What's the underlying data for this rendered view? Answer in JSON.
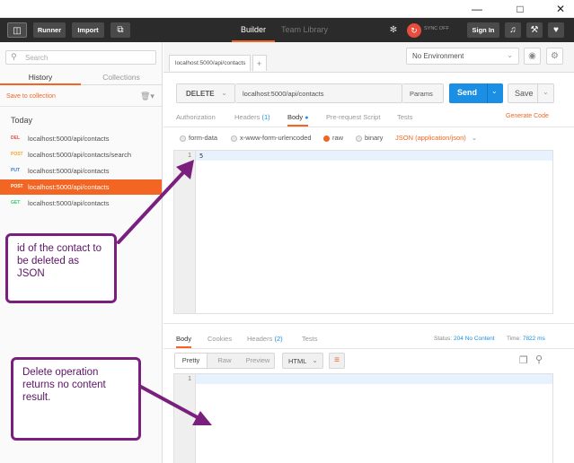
{
  "toolbar": {
    "runner": "Runner",
    "import": "Import",
    "builder": "Builder",
    "team_library": "Team Library",
    "sync": "SYNC OFF",
    "sign_in": "Sign In"
  },
  "sidebar": {
    "search_placeholder": "Search",
    "tabs": [
      "History",
      "Collections"
    ],
    "save_to_collection": "Save to collection",
    "section": "Today",
    "history": [
      {
        "method": "DEL",
        "url": "localhost:5000/api/contacts",
        "color": "#e74c3c"
      },
      {
        "method": "POST",
        "url": "localhost:5000/api/contacts/search",
        "color": "#f5a623"
      },
      {
        "method": "PUT",
        "url": "localhost:5000/api/contacts",
        "color": "#3a7bd5"
      },
      {
        "method": "POST",
        "url": "localhost:5000/api/contacts",
        "color": "#ffffff"
      },
      {
        "method": "GET",
        "url": "localhost:5000/api/contacts",
        "color": "#2ecc71"
      }
    ]
  },
  "request": {
    "tab_label": "localhost:5000/api/contacts",
    "environment": "No Environment",
    "method": "DELETE",
    "url": "localhost:5000/api/contacts",
    "params": "Params",
    "send": "Send",
    "save": "Save",
    "subtabs": {
      "authorization": "Authorization",
      "headers": "Headers",
      "headers_count": "(1)",
      "body": "Body",
      "prerequest": "Pre-request Script",
      "tests": "Tests",
      "generate_code": "Generate Code"
    },
    "body_types": {
      "form_data": "form-data",
      "urlencoded": "x-www-form-urlencoded",
      "raw": "raw",
      "binary": "binary",
      "content_type": "JSON (application/json)"
    },
    "editor": {
      "line": "1",
      "content": "5"
    }
  },
  "response": {
    "tabs": {
      "body": "Body",
      "cookies": "Cookies",
      "headers": "Headers",
      "headers_count": "(2)",
      "tests": "Tests"
    },
    "status_label": "Status:",
    "status_value": "204 No Content",
    "time_label": "Time:",
    "time_value": "7822 ms",
    "view_modes": [
      "Pretty",
      "Raw",
      "Preview"
    ],
    "format": "HTML",
    "editor_line": "1"
  },
  "annotations": {
    "top": "id of the contact to be deleted as JSON",
    "bottom": "Delete operation returns no content result.",
    "color": "#7b1f7f"
  }
}
